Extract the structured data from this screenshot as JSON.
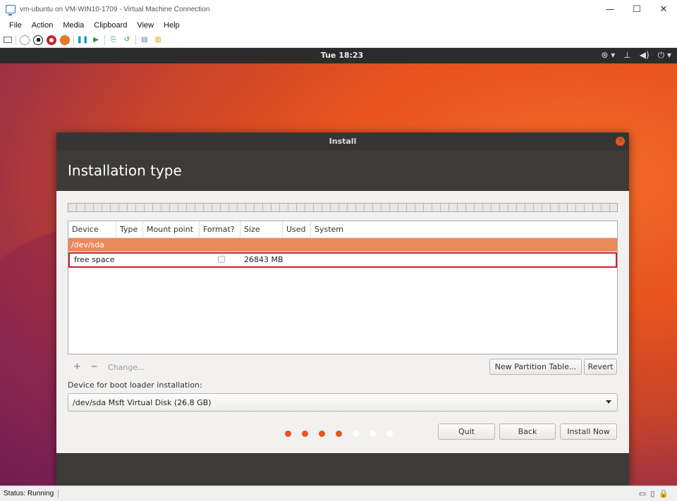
{
  "window": {
    "title": "vm-ubuntu on VM-WIN10-1709 - Virtual Machine Connection",
    "minimize": "—",
    "maximize": "☐",
    "close": "✕"
  },
  "menu": [
    "File",
    "Action",
    "Media",
    "Clipboard",
    "View",
    "Help"
  ],
  "toolbar_icons": [
    "ctrl-alt-del-icon",
    "start-icon",
    "turn-off-icon",
    "shutdown-icon",
    "save-icon",
    "pause-icon",
    "reset-icon",
    "checkpoint-icon",
    "revert-icon",
    "enhanced-session-icon",
    "share-icon"
  ],
  "desktop": {
    "clock": "Tue 18:23",
    "tray": {
      "accessibility": "⊛ ▾",
      "network": "⊥",
      "volume": "◀)",
      "power": "⏻ ▾"
    }
  },
  "dialog": {
    "title": "Install",
    "heading": "Installation type",
    "columns": [
      "Device",
      "Type",
      "Mount point",
      "Format?",
      "Size",
      "Used",
      "System"
    ],
    "device_row": "/dev/sda",
    "free_row": {
      "device": "free space",
      "size": "26843 MB"
    },
    "add_icon": "+",
    "remove_icon": "−",
    "change_label": "Change...",
    "new_partition_table": "New Partition Table...",
    "revert": "Revert",
    "bootloader_label": "Device for boot loader installation:",
    "bootloader_value": "/dev/sda Msft Virtual Disk (26.8 GB)",
    "buttons": {
      "quit": "Quit",
      "back": "Back",
      "install_now": "Install Now"
    }
  },
  "progress": {
    "total_steps": 7,
    "completed_steps": 4,
    "active_color": "#e95420",
    "inactive_color": "#ffffff"
  },
  "status": {
    "text": "Status: Running"
  }
}
